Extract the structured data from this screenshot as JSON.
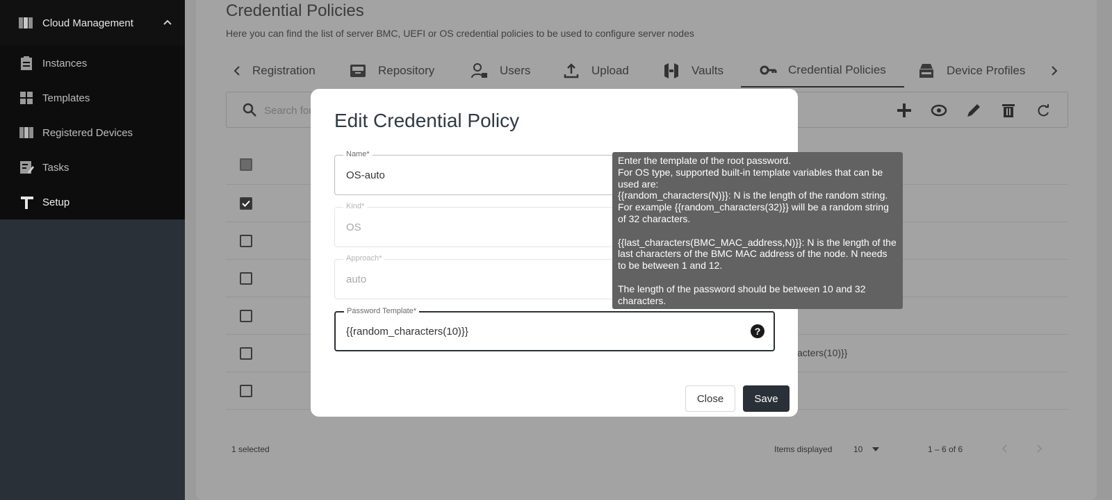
{
  "sidebar": {
    "header": {
      "label": "Cloud Management",
      "icon": "cloud-servers-icon"
    },
    "items": [
      {
        "label": "Instances",
        "icon": "clipboard-icon"
      },
      {
        "label": "Templates",
        "icon": "grid-icon"
      },
      {
        "label": "Registered Devices",
        "icon": "servers-icon"
      },
      {
        "label": "Tasks",
        "icon": "task-edit-icon"
      },
      {
        "label": "Setup",
        "icon": "setup-icon"
      }
    ]
  },
  "page": {
    "title": "Credential Policies",
    "subtitle": "Here you can find the list of server BMC, UEFI or OS credential policies to be used to configure server nodes"
  },
  "tabs": [
    {
      "label": "Registration"
    },
    {
      "label": "Repository"
    },
    {
      "label": "Users"
    },
    {
      "label": "Upload"
    },
    {
      "label": "Vaults"
    },
    {
      "label": "Credential Policies"
    },
    {
      "label": "Device Profiles"
    }
  ],
  "search": {
    "placeholder": "Search for"
  },
  "table": {
    "visible_cell_text": "acters(10)}}"
  },
  "footer": {
    "selected": "1 selected",
    "items_displayed_label": "Items displayed",
    "items_displayed_value": "10",
    "range": "1 – 6 of 6"
  },
  "modal": {
    "title": "Edit Credential Policy",
    "fields": {
      "name": {
        "label": "Name*",
        "value": "OS-auto"
      },
      "kind": {
        "label": "Kind*",
        "value": "OS"
      },
      "approach": {
        "label": "Approach*",
        "value": "auto"
      },
      "password_template": {
        "label": "Password Template*",
        "value": "{{random_characters(10)}}"
      }
    },
    "close_label": "Close",
    "save_label": "Save"
  },
  "tooltip": {
    "line1": "Enter the template of the root password.",
    "line2": "For OS type, supported built-in template variables that can be used are:",
    "line3": "{{random_characters(N)}}: N is the length of the random string. For example {{random_characters(32)}} will be a random string of 32 characters.",
    "line4": "{{last_characters(BMC_MAC_address,N)}}: N is the length of the last characters of the BMC MAC address of the node. N needs to be between 1 and 12.",
    "line5": "The length of the password should be between 10 and 32 characters."
  },
  "colors": {
    "sidebar_bg": "#2a3037",
    "primary_button": "#2a3037",
    "overlay": "#9b9b9b",
    "tooltip_bg": "#626262"
  }
}
